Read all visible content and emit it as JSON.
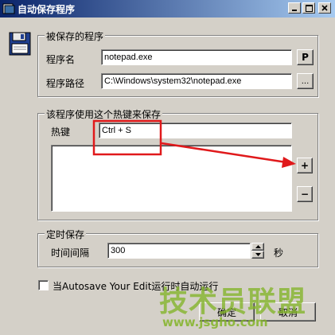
{
  "window": {
    "title": "自动保存程序"
  },
  "program_group": {
    "legend": "被保存的程序",
    "name_label": "程序名",
    "name_value": "notepad.exe",
    "name_button": "P",
    "path_label": "程序路径",
    "path_value": "C:\\Windows\\system32\\notepad.exe",
    "browse_button": "..."
  },
  "hotkey_group": {
    "legend": "该程序使用这个热键来保存",
    "hotkey_label": "热键",
    "hotkey_value": "Ctrl + S",
    "add_button": "+",
    "remove_button": "−",
    "highlight_color": "#e0191b"
  },
  "timer_group": {
    "legend": "定时保存",
    "interval_label": "时间间隔",
    "interval_value": "300",
    "unit": "秒"
  },
  "autostart": {
    "label": "当Autosave Your Edit运行时自动运行",
    "checked": false
  },
  "footer": {
    "ok_button": "确定",
    "cancel_button": "取消"
  },
  "watermark": {
    "text": "技术员联盟",
    "url": "www.jsgho.com"
  }
}
